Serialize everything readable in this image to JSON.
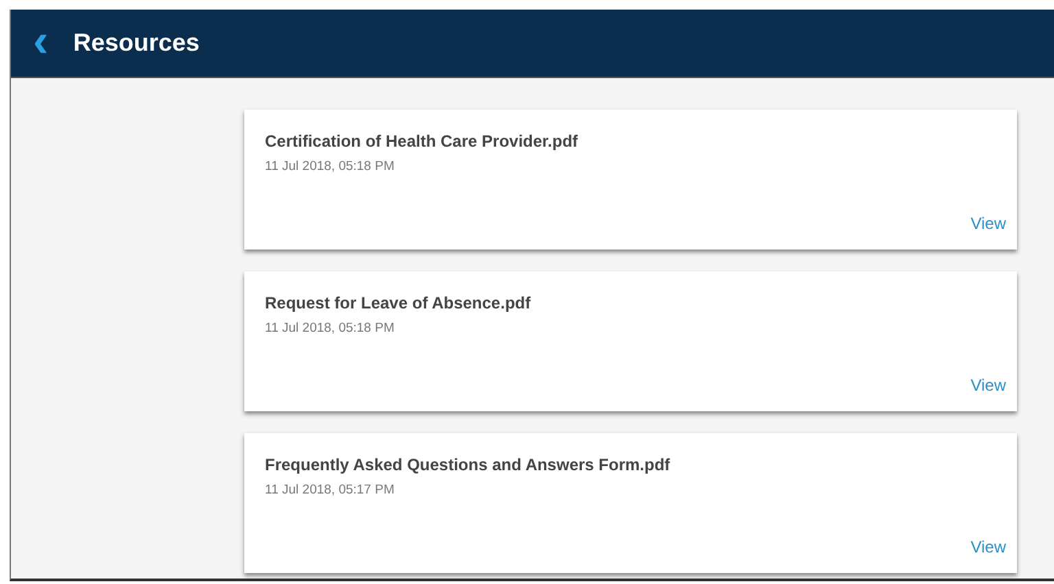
{
  "header": {
    "back_icon": "‹",
    "title": "Resources"
  },
  "resources": [
    {
      "name": "Certification of Health Care Provider.pdf",
      "date": "11 Jul 2018, 05:18 PM",
      "action": "View"
    },
    {
      "name": "Request for Leave of Absence.pdf",
      "date": "11 Jul 2018, 05:18 PM",
      "action": "View"
    },
    {
      "name": "Frequently Asked Questions and Answers Form.pdf",
      "date": "11 Jul 2018, 05:17 PM",
      "action": "View"
    }
  ]
}
